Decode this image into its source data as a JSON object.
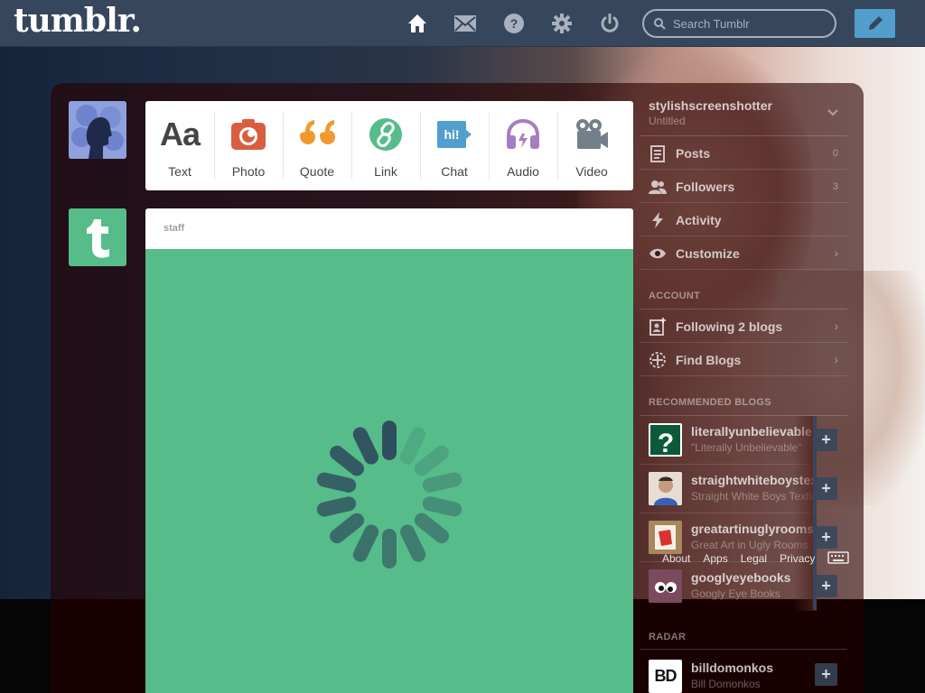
{
  "header": {
    "logo": "tumblr.",
    "nav": [
      {
        "name": "home-icon"
      },
      {
        "name": "inbox-icon"
      },
      {
        "name": "help-icon"
      },
      {
        "name": "settings-icon"
      },
      {
        "name": "logout-icon"
      }
    ],
    "search_placeholder": "Search Tumblr",
    "compose_icon": "pencil-icon"
  },
  "post_types": [
    {
      "label": "Text",
      "icon": "text-icon",
      "color": "#444444"
    },
    {
      "label": "Photo",
      "icon": "camera-icon",
      "color": "#d95e40"
    },
    {
      "label": "Quote",
      "icon": "quote-icon",
      "color": "#f2992e"
    },
    {
      "label": "Link",
      "icon": "link-icon",
      "color": "#56bc8a"
    },
    {
      "label": "Chat",
      "icon": "chat-icon",
      "color": "#529ecc"
    },
    {
      "label": "Audio",
      "icon": "headphones-icon",
      "color": "#a77dc2"
    },
    {
      "label": "Video",
      "icon": "video-camera-icon",
      "color": "#748089"
    }
  ],
  "post": {
    "author": "staff",
    "background": "#56bc8a"
  },
  "sidebar": {
    "blog_name": "stylishscreenshotter",
    "blog_title": "Untitled",
    "blog_items": [
      {
        "label": "Posts",
        "count": "0",
        "icon": "posts-icon"
      },
      {
        "label": "Followers",
        "count": "3",
        "icon": "followers-icon"
      },
      {
        "label": "Activity",
        "count": "",
        "icon": "activity-icon"
      },
      {
        "label": "Customize",
        "count": "",
        "icon": "eye-icon"
      }
    ],
    "account_heading": "ACCOUNT",
    "account_items": [
      {
        "label": "Following 2 blogs",
        "icon": "following-icon"
      },
      {
        "label": "Find Blogs",
        "icon": "compass-icon"
      }
    ],
    "recommended_heading": "RECOMMENDED BLOGS",
    "recommended": [
      {
        "name": "literallyunbelievable",
        "subtitle": "\"Literally Unbelievable\""
      },
      {
        "name": "straightwhiteboystexting",
        "subtitle": "Straight White Boys Texting"
      },
      {
        "name": "greatartinuglyrooms",
        "subtitle": "Great Art in Ugly Rooms"
      },
      {
        "name": "googlyeyebooks",
        "subtitle": "Googly Eye Books"
      }
    ],
    "footer_links": [
      "About",
      "Apps",
      "Legal",
      "Privacy"
    ],
    "radar_heading": "RADAR",
    "radar": {
      "name": "billdomonkos",
      "subtitle": "Bill Domonkos",
      "thumb_text": "BD"
    }
  }
}
